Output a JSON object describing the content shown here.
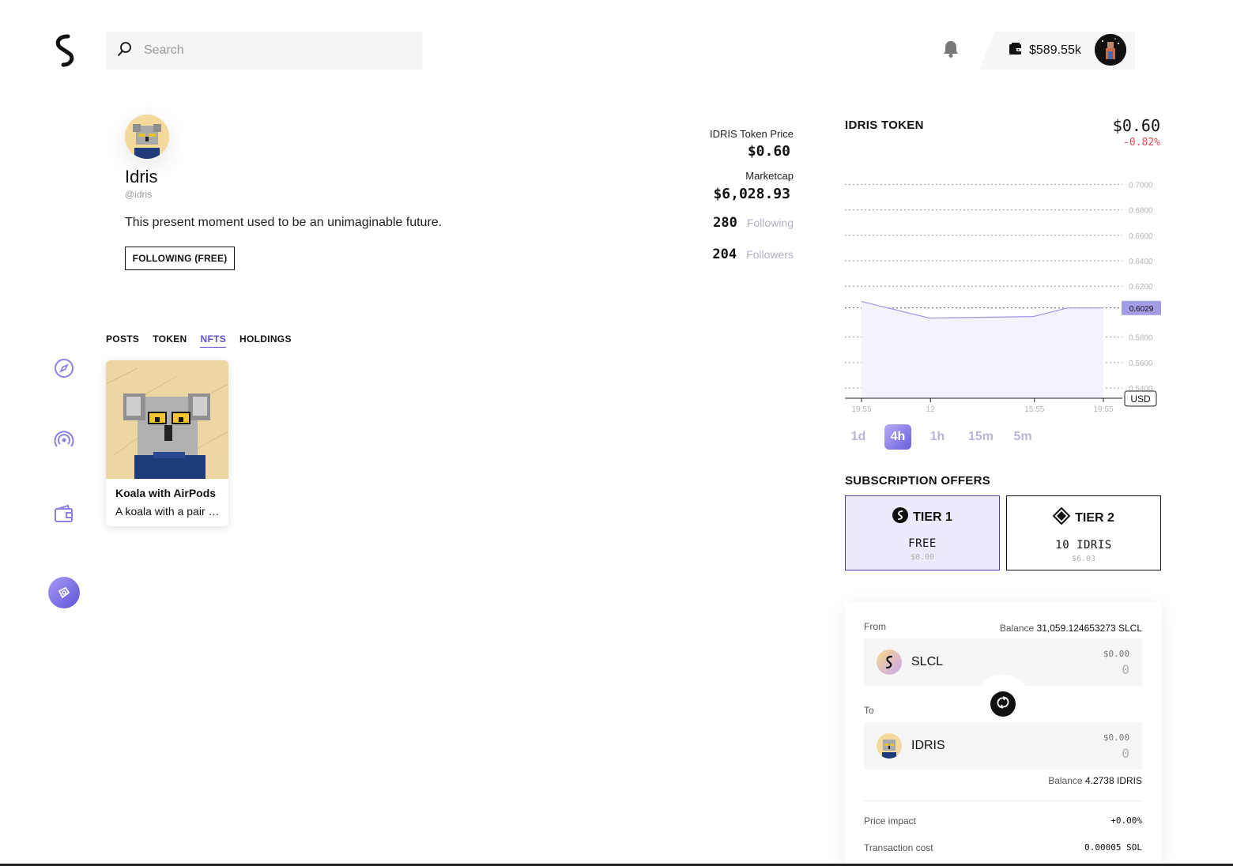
{
  "header": {
    "search_placeholder": "Search",
    "wallet_balance": "$589.55k"
  },
  "profile": {
    "name": "Idris",
    "handle": "@idris",
    "bio": "This present moment used to be an unimaginable future.",
    "follow_button": "FOLLOWING (FREE)"
  },
  "stats": {
    "price_label": "IDRIS Token Price",
    "price_value": "$0.60",
    "marketcap_label": "Marketcap",
    "marketcap_value": "$6,028.93",
    "following_count": "280",
    "following_label": "Following",
    "followers_count": "204",
    "followers_label": "Followers"
  },
  "tabs": [
    {
      "label": "POSTS",
      "active": false
    },
    {
      "label": "TOKEN",
      "active": false
    },
    {
      "label": "NFTS",
      "active": true
    },
    {
      "label": "HOLDINGS",
      "active": false
    }
  ],
  "nft": {
    "title": "Koala with AirPods",
    "description": "A koala with a pair of AirPods"
  },
  "chart_data": {
    "type": "area",
    "title": "IDRIS TOKEN",
    "current_price": "$0.60",
    "change": "-0.82%",
    "currency": "USD",
    "x_ticks": [
      "19:55",
      "12",
      "15:55",
      "19:55"
    ],
    "y_ticks": [
      "0.7000",
      "0.6800",
      "0.6600",
      "0.6400",
      "0.6200",
      "0.5800",
      "0.5600",
      "0.5400"
    ],
    "y_range": [
      0.532,
      0.7083
    ],
    "last_value_label": "0.6029",
    "series": [
      {
        "x": [
          0,
          0.28,
          0.71,
          0.85,
          1.0
        ],
        "y": [
          0.608,
          0.595,
          0.5962,
          0.6029,
          0.6029
        ]
      }
    ],
    "color": "#9d97e6",
    "fill": "#f3f2fd"
  },
  "intervals": [
    {
      "label": "1d",
      "active": false
    },
    {
      "label": "4h",
      "active": true
    },
    {
      "label": "1h",
      "active": false
    },
    {
      "label": "15m",
      "active": false
    },
    {
      "label": "5m",
      "active": false
    }
  ],
  "subscription": {
    "title": "SUBSCRIPTION OFFERS",
    "tiers": [
      {
        "name": "TIER 1",
        "price": "FREE",
        "usd": "$0.00"
      },
      {
        "name": "TIER 2",
        "price": "10 IDRIS",
        "usd": "$6.03"
      }
    ]
  },
  "swap": {
    "from_label": "From",
    "from_balance_label": "Balance",
    "from_balance": "31,059.124653273 SLCL",
    "from_token": "SLCL",
    "from_usd": "$0.00",
    "from_amount": "0",
    "to_label": "To",
    "to_token": "IDRIS",
    "to_usd": "$0.00",
    "to_amount": "0",
    "to_balance_label": "Balance",
    "to_balance": "4.2738 IDRIS",
    "price_impact_label": "Price impact",
    "price_impact": "+0.00%",
    "tx_cost_label": "Transaction cost",
    "tx_cost": "0.00005 SOL"
  },
  "colors": {
    "accent": "#5b50d6",
    "negative": "#e04b5a",
    "muted": "#b1b1c8"
  }
}
